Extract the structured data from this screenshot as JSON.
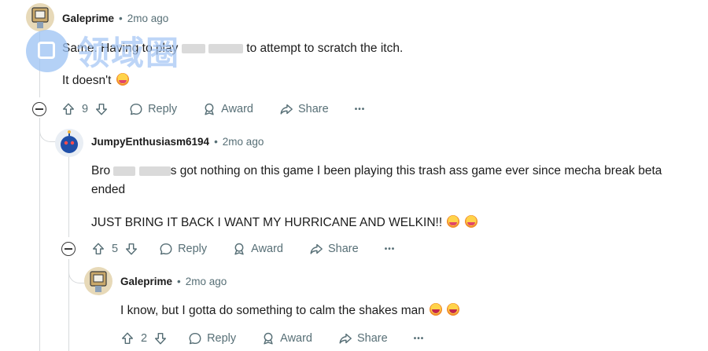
{
  "comments": [
    {
      "author": "Galeprime",
      "separator": "•",
      "time": "2mo ago",
      "line1_before": "Same. Having to play ",
      "line1_after": " to attempt to scratch the itch.",
      "line2": "It doesn't",
      "votes": "9",
      "reply": "Reply",
      "award": "Award",
      "share": "Share",
      "more": "•••"
    },
    {
      "author": "JumpyEnthusiasm6194",
      "separator": "•",
      "time": "2mo ago",
      "line1_before": "Bro ",
      "line1_after": "s got nothing on this game I been playing this trash ass game ever since mecha break beta",
      "line1_cont": "ended",
      "line2": "JUST BRING IT BACK I WANT MY HURRICANE AND WELKIN!!",
      "votes": "5",
      "reply": "Reply",
      "award": "Award",
      "share": "Share",
      "more": "•••"
    },
    {
      "author": "Galeprime",
      "separator": "•",
      "time": "2mo ago",
      "line1": "I know, but I gotta do something to calm the shakes man",
      "votes": "2",
      "reply": "Reply",
      "award": "Award",
      "share": "Share",
      "more": "•••"
    }
  ],
  "watermark": {
    "text": "领域圈"
  },
  "icons": {
    "upvote": "upvote-arrow-icon",
    "downvote": "downvote-arrow-icon",
    "reply": "speech-bubble-icon",
    "award": "award-ribbon-icon",
    "share": "share-arrow-icon",
    "collapse": "collapse-minus-icon"
  },
  "colors": {
    "meta": "#576f76",
    "thread": "#d7dadc",
    "text": "#1c1c1c"
  }
}
